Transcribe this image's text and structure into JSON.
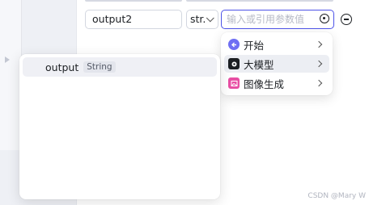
{
  "output_row": {
    "name_value": "output2",
    "type_value": "str.",
    "value_placeholder": "输入或引用参数值"
  },
  "reference_menu": {
    "items": [
      {
        "label": "开始",
        "icon": "start-icon",
        "color": "#6f6ff3"
      },
      {
        "label": "大模型",
        "icon": "llm-icon",
        "color": "#1c1f23"
      },
      {
        "label": "图像生成",
        "icon": "image-gen-icon",
        "color": "#e84fa4"
      }
    ]
  },
  "variable_list": {
    "items": [
      {
        "name": "output",
        "type": "String"
      }
    ]
  },
  "watermark": "CSDN @Mary W"
}
